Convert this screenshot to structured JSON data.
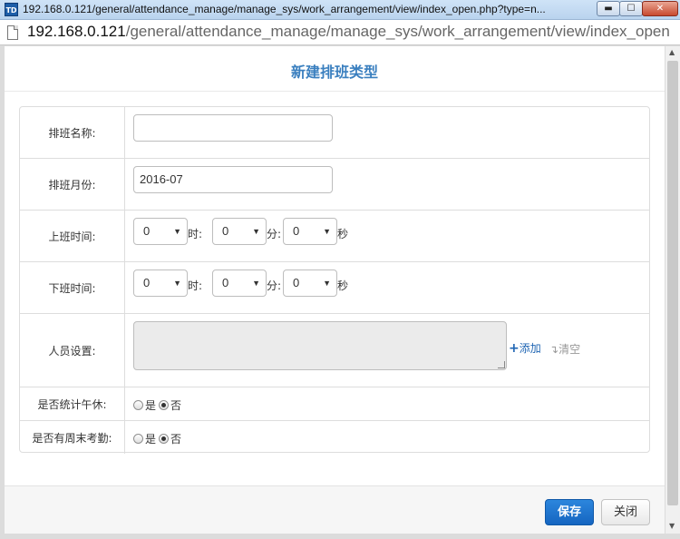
{
  "window": {
    "app_icon": "TD",
    "title": "192.168.0.121/general/attendance_manage/manage_sys/work_arrangement/view/index_open.php?type=n...",
    "min_glyph": "▬",
    "max_glyph": "☐",
    "close_glyph": "✕"
  },
  "address": {
    "host": "192.168.0.121",
    "path": "/general/attendance_manage/manage_sys/work_arrangement/view/index_open"
  },
  "form": {
    "title": "新建排班类型",
    "name_label": "排班名称:",
    "name_value": "",
    "month_label": "排班月份:",
    "month_value": "2016-07",
    "start_label": "上班时间:",
    "start_hour": "0",
    "start_minute": "0",
    "start_second": "0",
    "end_label": "下班时间:",
    "end_hour": "0",
    "end_minute": "0",
    "end_second": "0",
    "unit_hour": "时:",
    "unit_minute": "分:",
    "unit_second": "秒",
    "staff_label": "人员设置:",
    "add_label": "添加",
    "clear_label": "清空",
    "lunch_label": "是否统计午休:",
    "weekend_label": "是否有周末考勤:",
    "yes_label": "是",
    "no_label": "否",
    "lunch_selected": "否",
    "weekend_selected": "否"
  },
  "footer": {
    "save_label": "保存",
    "close_label": "关闭"
  },
  "colors": {
    "title_blue": "#3a7fbf",
    "primary_button": "#1a6fcf",
    "link_blue": "#1f65b3"
  }
}
